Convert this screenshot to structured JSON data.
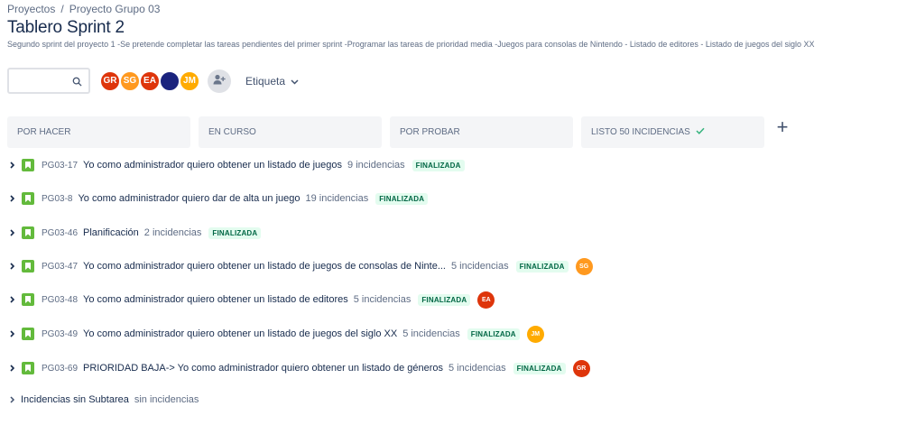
{
  "breadcrumb": {
    "projects": "Proyectos",
    "separator": "/",
    "project": "Proyecto Grupo 03"
  },
  "title": "Tablero Sprint 2",
  "subtitle": "Segundo sprint del proyecto 1 -Se pretende completar las tareas pendientes del primer sprint -Programar las tareas de prioridad media -Juegos para consolas de Nintendo - Listado de editores - Listado de juegos del siglo XX",
  "toolbar": {
    "search_value": "",
    "avatars": [
      {
        "initials": "GR",
        "color": "#de350b"
      },
      {
        "initials": "SG",
        "color": "#ff991f"
      },
      {
        "initials": "EA",
        "color": "#de350b"
      },
      {
        "initials": "",
        "color": "#1a237e"
      },
      {
        "initials": "JM",
        "color": "#ffab00"
      }
    ],
    "label_filter": "Etiqueta"
  },
  "columns": [
    {
      "label": "POR HACER"
    },
    {
      "label": "EN CURSO"
    },
    {
      "label": "POR PROBAR"
    },
    {
      "label": "LISTO 50 INCIDENCIAS"
    }
  ],
  "add_column": "+",
  "rows": [
    {
      "key": "PG03-17",
      "summary": "Yo como administrador quiero obtener un listado de juegos",
      "count": "9 incidencias",
      "status": "FINALIZADA",
      "avatar": null
    },
    {
      "key": "PG03-8",
      "summary": "Yo como administrador quiero dar de alta un juego",
      "count": "19 incidencias",
      "status": "FINALIZADA",
      "avatar": null
    },
    {
      "key": "PG03-46",
      "summary": "Planificación",
      "count": "2 incidencias",
      "status": "FINALIZADA",
      "avatar": null
    },
    {
      "key": "PG03-47",
      "summary": "Yo como administrador quiero obtener un listado de juegos de consolas de Ninte...",
      "count": "5 incidencias",
      "status": "FINALIZADA",
      "avatar": {
        "initials": "SG",
        "color": "#ff991f"
      }
    },
    {
      "key": "PG03-48",
      "summary": "Yo como administrador quiero obtener un listado de editores",
      "count": "5 incidencias",
      "status": "FINALIZADA",
      "avatar": {
        "initials": "EA",
        "color": "#de350b"
      }
    },
    {
      "key": "PG03-49",
      "summary": "Yo como administrador quiero obtener un listado de juegos del siglo XX",
      "count": "5 incidencias",
      "status": "FINALIZADA",
      "avatar": {
        "initials": "JM",
        "color": "#ffab00"
      }
    },
    {
      "key": "PG03-69",
      "summary": "PRIORIDAD BAJA-> Yo como administrador quiero obtener un listado de géneros",
      "count": "5 incidencias",
      "status": "FINALIZADA",
      "avatar": {
        "initials": "GR",
        "color": "#de350b"
      }
    }
  ],
  "no_subtask": {
    "label": "Incidencias sin Subtarea",
    "count": "sin incidencias"
  }
}
